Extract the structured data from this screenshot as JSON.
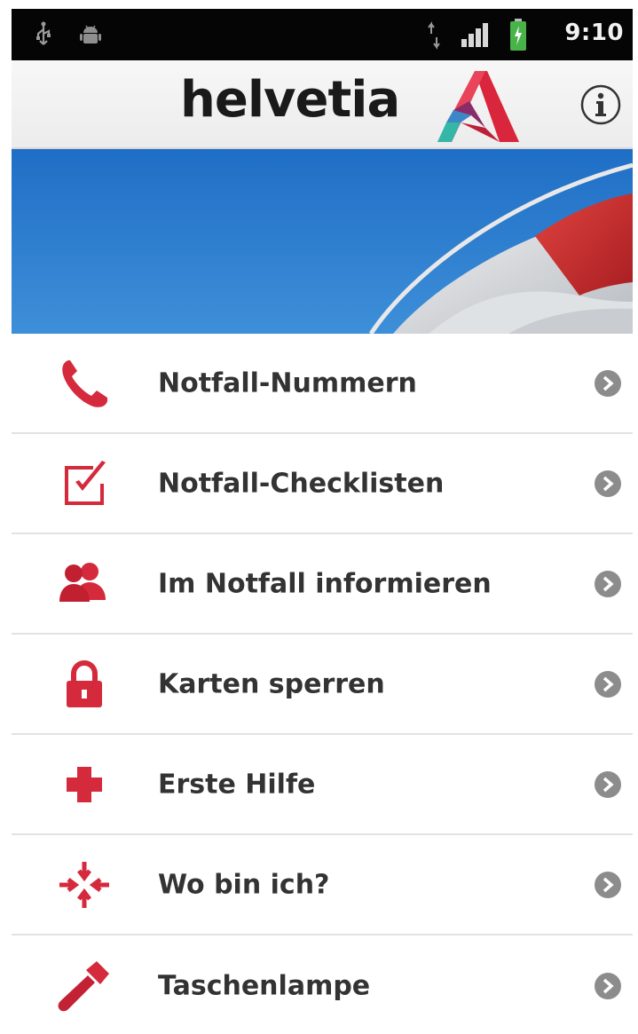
{
  "status_bar": {
    "time": "9:10",
    "left_icons": [
      "usb-icon",
      "android-debug-icon"
    ],
    "right_icons": [
      "data-arrows-icon",
      "signal-icon",
      "battery-icon"
    ]
  },
  "header": {
    "logo_text": "helvetia",
    "logo_icon": "helvetia-logo-icon",
    "info_icon": "info-icon"
  },
  "banner": {
    "image": "lifebuoy-banner"
  },
  "menu": {
    "items": [
      {
        "label": "Notfall-Nummern",
        "icon": "phone-icon"
      },
      {
        "label": "Notfall-Checklisten",
        "icon": "checklist-icon"
      },
      {
        "label": "Im Notfall informieren",
        "icon": "people-icon"
      },
      {
        "label": "Karten sperren",
        "icon": "lock-icon"
      },
      {
        "label": "Erste Hilfe",
        "icon": "first-aid-cross-icon"
      },
      {
        "label": "Wo bin ich?",
        "icon": "location-arrows-icon"
      },
      {
        "label": "Taschenlampe",
        "icon": "flashlight-icon"
      }
    ]
  },
  "colors": {
    "accent": "#d42a3c",
    "status_bar": "#050505",
    "text": "#333333",
    "banner_sky": "#1c6fc4",
    "chevron": "#8c8c8c"
  }
}
